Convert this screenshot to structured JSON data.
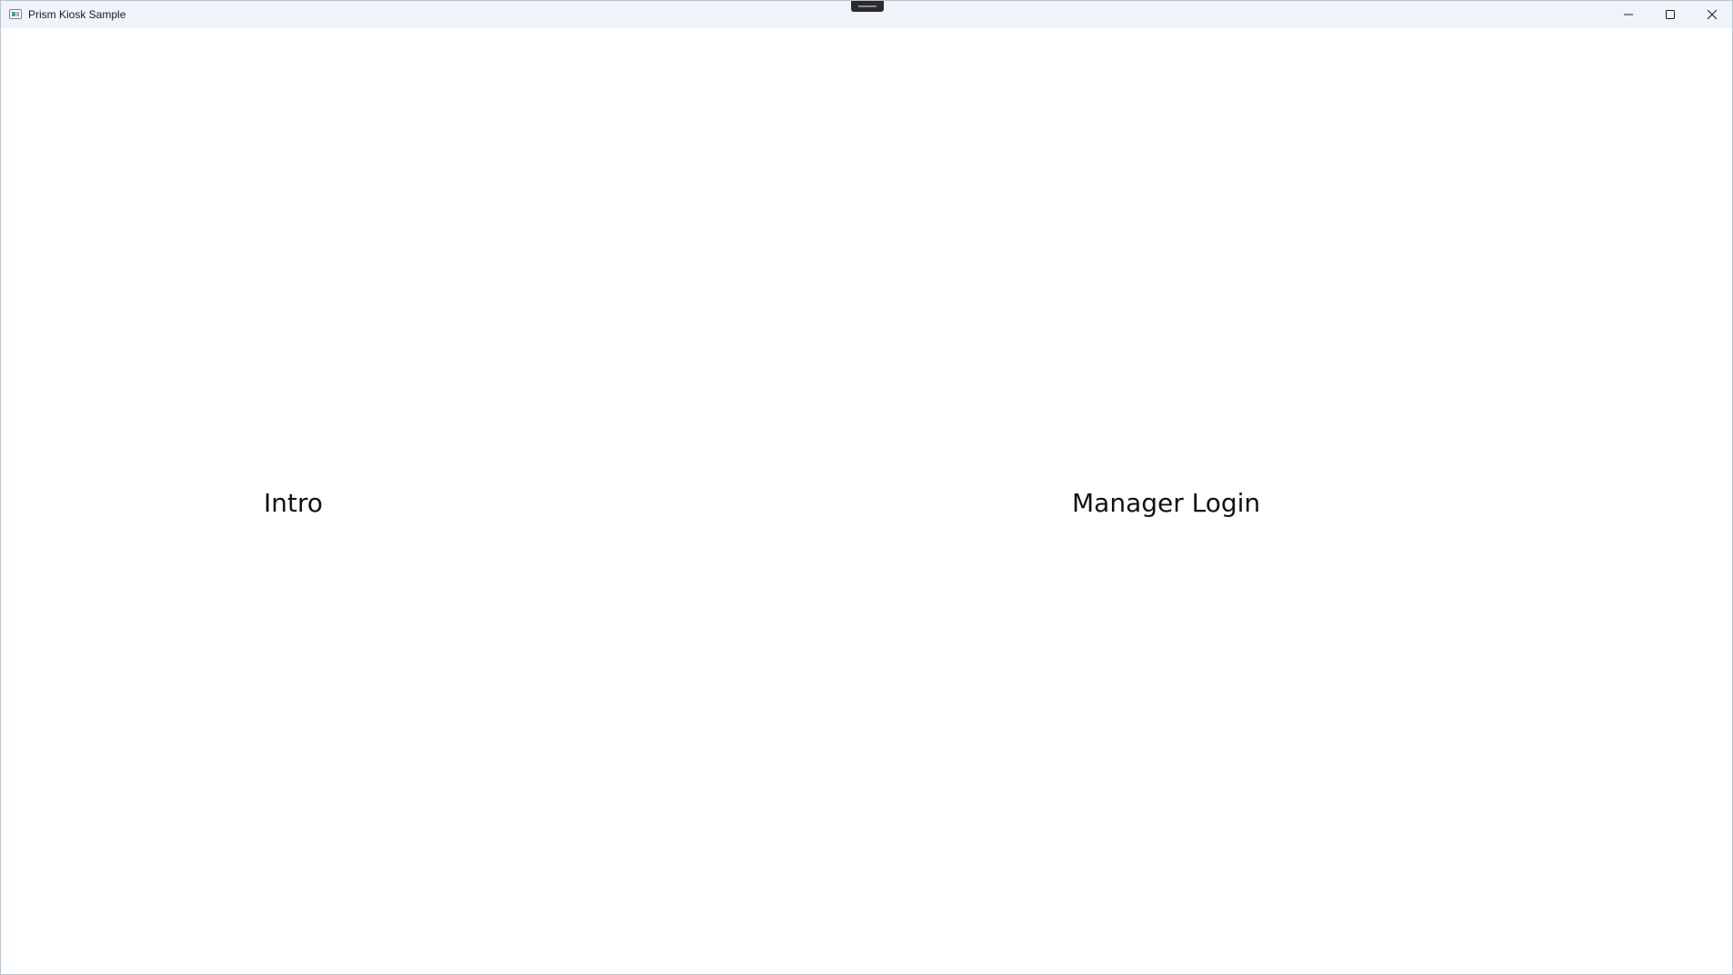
{
  "window": {
    "title": "Prism Kiosk Sample",
    "app_icon": "app-window-icon",
    "controls": {
      "minimize_icon": "minimize-icon",
      "maximize_icon": "maximize-icon",
      "close_icon": "close-icon"
    }
  },
  "regions": {
    "left_label": "Intro",
    "right_label": "Manager Login"
  },
  "colors": {
    "titlebar": "#eef4fa",
    "background": "#ffffff",
    "text": "#111111"
  }
}
